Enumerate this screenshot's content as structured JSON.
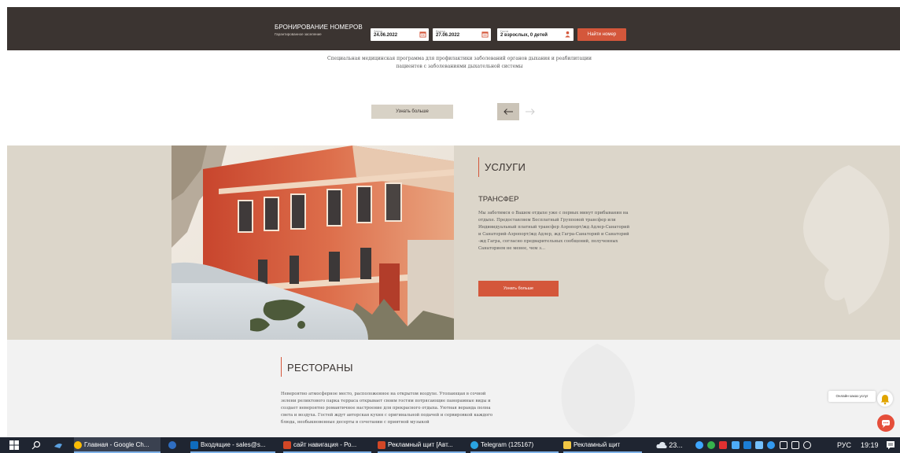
{
  "booking": {
    "title": "БРОНИРОВАНИЕ НОМЕРОВ",
    "subtitle": "Гарантированное заселение",
    "checkin_label": "Заезд",
    "checkin_value": "24.06.2022",
    "checkout_label": "Выезд",
    "checkout_value": "27.06.2022",
    "guests_label": "Гости",
    "guests_value": "2 взрослых, 0 детей",
    "find_button": "Найти номер"
  },
  "program": {
    "description": "Специальная медицинская программа для профилактики заболеваний органов дыхания и реабилитации пациентов с заболеваниями дыхательной системы",
    "more_button": "Узнать больше",
    "prev_icon": "arrow-left-icon",
    "next_icon": "arrow-right-icon"
  },
  "services": {
    "title": "УСЛУГИ",
    "subtitle": "ТРАНСФЕР",
    "text": "Мы заботимся о Вашем отдыхе уже с первых минут прибывания на отдыхе. Предоставляем Бесплатный Групповой трансфер или Индивидуальный платный трансфер Аэропорт/жд Адлер-Санаторий и Санаторий-Аэропорт/жд Адлер, жд Гагра-Санаторий и Санаторий -жд Гагра, согласно предварительных сообщений, полученных Санаторием не менее, чем з...",
    "more_button": "Узнать больше"
  },
  "restaurants": {
    "title": "РЕСТОРАНЫ",
    "text": "Невероятно атмосферное место, расположенное на открытом воздухе. Утопающая в сочной зелени реликтового парка терраса открывает своим гостям потрясающие панорамные виды и создает невероятно романтичное настроение для прекрасного отдыха. Уютная веранда полна света и воздуха. Гостей ждут авторская кухня с оригинальной подачей и сервировкой каждого блюда, необыкновенные десерты в сочетании с приятной музыкой"
  },
  "widgets": {
    "chat_label": "Онлайн-заказ услуг",
    "bell_icon": "bell-icon",
    "chat_icon": "chat-icon"
  },
  "taskbar": {
    "items": [
      {
        "label": "Главная - Google Ch...",
        "color": "#fbbc05"
      },
      {
        "label": "",
        "color": "#2f6ec2"
      },
      {
        "label": "Входящие - sales@s...",
        "color": "#0f6cbd"
      },
      {
        "label": "сайт навигация - Ро...",
        "color": "#d24726"
      },
      {
        "label": "Рекламный щит [Авт...",
        "color": "#d24726"
      },
      {
        "label": "Telegram (125167)",
        "color": "#2aa3e0"
      },
      {
        "label": "Рекламный щит",
        "color": "#f2c744"
      }
    ],
    "weather": "23...",
    "language": "РУС",
    "time": "19:19"
  },
  "colors": {
    "accent": "#d4573b",
    "dark": "#3b3431",
    "beige": "#dcd6ca"
  }
}
